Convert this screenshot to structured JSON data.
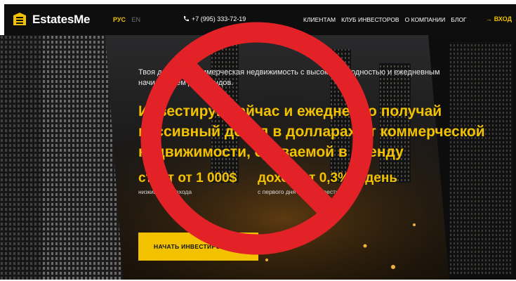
{
  "header": {
    "brand": "EstatesMe",
    "lang_ru": "РУС",
    "lang_en": "EN",
    "phone": "+7 (995) 333-72-19",
    "nav": [
      "КЛИЕНТАМ",
      "КЛУБ ИНВЕСТОРОВ",
      "О КОМПАНИИ",
      "БЛОГ"
    ],
    "login_arrow": "→",
    "login": "ВХОД"
  },
  "hero": {
    "intro_line1": "Твоя доходная коммерческая недвижимость с высокой доходностью и ежедневным",
    "intro_line2": "начислением дивидендов.",
    "headline_line1": "Инвестируй сейчас и ежедневно получай",
    "headline_line2": "пассивный доход в долларах от коммерческой",
    "headline_line3": "недвижимости, сдаваемой в аренду",
    "stat1": "старт от 1 000$",
    "stat1_note": "низкий порог входа",
    "stat2": "доход от 0,3% в день",
    "stat2_note": "с первого дня вашей инвестиции",
    "cta": "НАЧАТЬ ИНВЕСТИРОВАТЬ"
  },
  "colors": {
    "accent": "#f2c200",
    "header_bg": "#0e0e0e",
    "ban_red": "#e32227"
  },
  "icons": [
    "estatesme-logo-icon",
    "phone-icon",
    "prohibition-sign-icon"
  ]
}
